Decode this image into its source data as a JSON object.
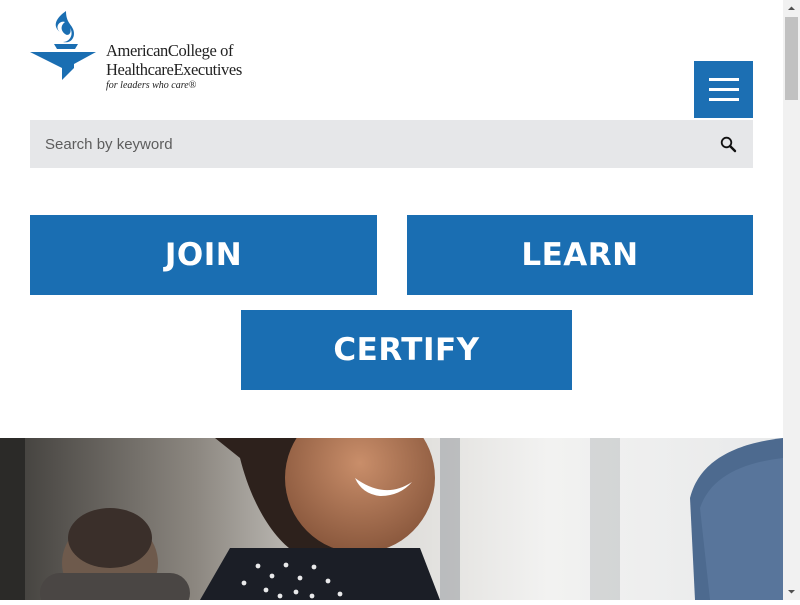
{
  "header": {
    "logo": {
      "line1": "AmericanCollege of",
      "line2": "HealthcareExecutives",
      "tagline": "for leaders who care®"
    },
    "menu_icon": "hamburger-menu-icon"
  },
  "search": {
    "placeholder": "Search by keyword",
    "icon": "search-icon"
  },
  "actions": {
    "join_label": "JOIN",
    "learn_label": "LEARN",
    "certify_label": "CERTIFY"
  },
  "colors": {
    "brand_blue": "#1a6eb2",
    "search_bg": "#e6e7e9",
    "page_bg": "#ffffff"
  }
}
